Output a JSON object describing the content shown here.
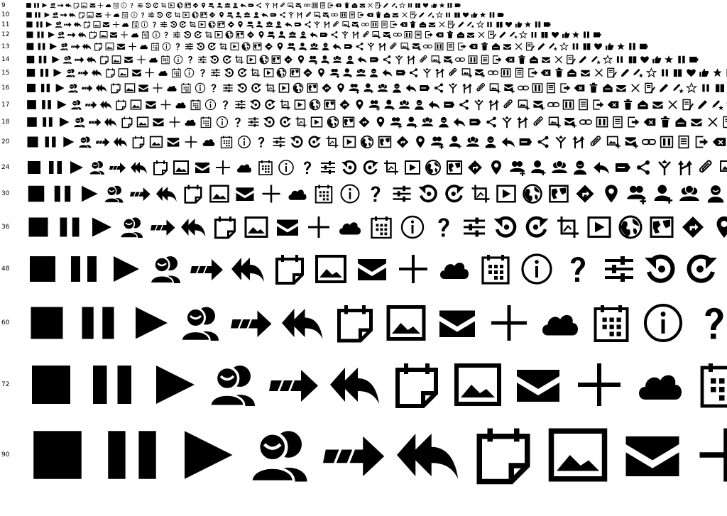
{
  "specimen": {
    "rows": [
      {
        "size": "9"
      },
      {
        "size": "10"
      },
      {
        "size": "11"
      },
      {
        "size": "12"
      },
      {
        "size": "13"
      },
      {
        "size": "14"
      },
      {
        "size": "15"
      },
      {
        "size": "16"
      },
      {
        "size": "17"
      },
      {
        "size": "18"
      },
      {
        "size": "20"
      },
      {
        "size": "24"
      },
      {
        "size": "30"
      },
      {
        "size": "36"
      },
      {
        "size": "48"
      },
      {
        "size": "60"
      },
      {
        "size": "72"
      },
      {
        "size": "90"
      }
    ],
    "icons": [
      "stop-icon",
      "pause-icon",
      "play-icon",
      "users-icon",
      "forward-icon",
      "reply-all-icon",
      "note-icon",
      "image-icon",
      "mail-icon",
      "plus-icon",
      "cloud-icon",
      "calendar-icon",
      "info-icon",
      "question-icon",
      "sliders-icon",
      "undo-icon",
      "redo-icon",
      "crop-icon",
      "video-icon",
      "globe-icon",
      "map-icon",
      "directions-icon",
      "location-pin-icon",
      "group-add-icon",
      "user-add-icon",
      "group-icon",
      "user-icon",
      "reply-icon",
      "tag-icon",
      "share-icon",
      "merge-icon",
      "split-icon",
      "attach-icon",
      "image-add-icon",
      "mail-add-icon",
      "link-icon",
      "columns-icon",
      "document-icon",
      "export-icon",
      "backspace-icon",
      "trash-icon",
      "inbox-icon",
      "mail-open-icon",
      "close-icon",
      "document-edit-icon",
      "pen-icon",
      "pen-star-icon",
      "star-icon",
      "pause-small-icon",
      "book-icon",
      "heart-icon",
      "thumbs-icon",
      "star-fill-icon",
      "bars-icon",
      "battery-icon"
    ]
  }
}
